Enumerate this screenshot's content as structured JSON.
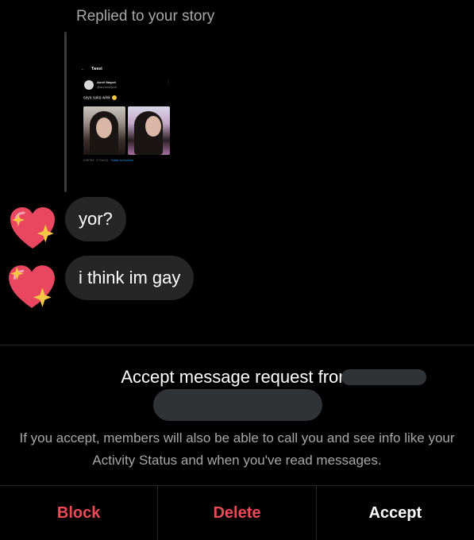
{
  "story": {
    "replied_label": "Replied to your story",
    "tweet": {
      "header": "Tweet",
      "back": "←",
      "name": "Aurel Mayori",
      "handle": "@aurelmayori",
      "more": "⋮",
      "text": "saya suka wink",
      "meta_time": "6:38 PM · 27 Oct 21 · ",
      "meta_source": "Twitter for Android"
    }
  },
  "messages": [
    {
      "text": "yor?",
      "reaction": "sparkling-heart"
    },
    {
      "text": "i think im gay",
      "reaction": "sparkling-heart"
    }
  ],
  "request": {
    "title": "Accept message request from",
    "description": "If you accept, members will also be able to call you and see info like your Activity Status and when you've read messages."
  },
  "actions": {
    "block": "Block",
    "delete": "Delete",
    "accept": "Accept"
  },
  "colors": {
    "background": "#000000",
    "bubble": "#262626",
    "danger": "#ed4956",
    "muted_text": "#a8a8a8",
    "heart": "#e94660",
    "sparkle": "#f6c744"
  }
}
